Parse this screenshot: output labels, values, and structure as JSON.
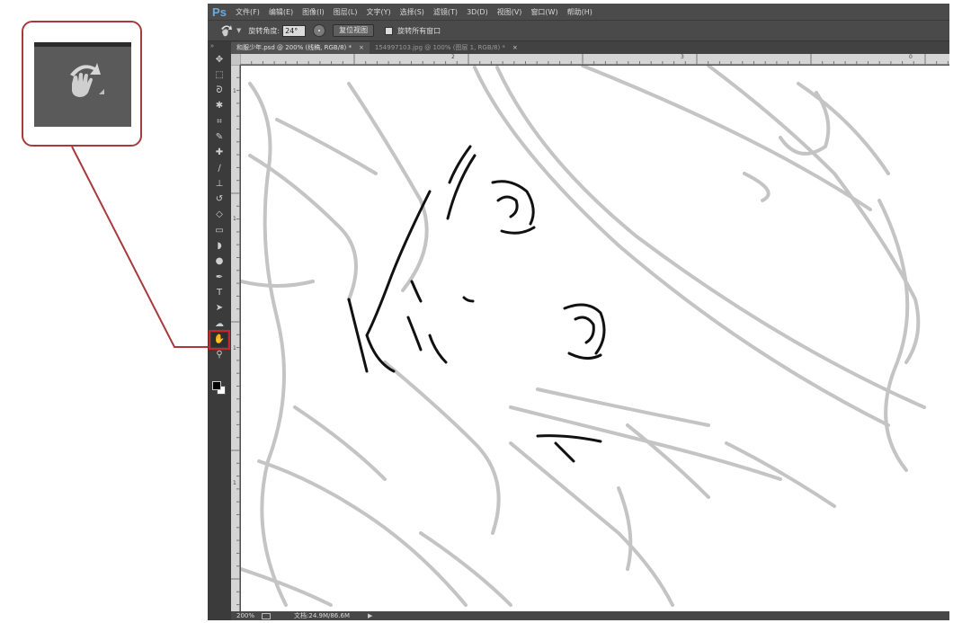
{
  "app": {
    "logo": "Ps",
    "menu": [
      "文件(F)",
      "编辑(E)",
      "图像(I)",
      "图层(L)",
      "文字(Y)",
      "选择(S)",
      "滤镜(T)",
      "3D(D)",
      "视图(V)",
      "窗口(W)",
      "帮助(H)"
    ]
  },
  "options": {
    "tool_icon": "rotate-view-icon",
    "angle_label": "旋转角度:",
    "angle_value": "24°",
    "reset_label": "复位视图",
    "rotate_all_label": "旋转所有窗口",
    "rotate_all_checked": false
  },
  "tabs": [
    {
      "label": "和服少年.psd @ 200% (线稿, RGB/8) *",
      "active": true,
      "close": "×"
    },
    {
      "label": "154997103.jpg @ 100% (图层 1, RGB/8) *",
      "active": false,
      "close": "×"
    }
  ],
  "toolbox": {
    "grip": "»",
    "tools": [
      {
        "name": "move-tool",
        "glyph": "✥"
      },
      {
        "name": "marquee-tool",
        "glyph": "⬚"
      },
      {
        "name": "lasso-tool",
        "glyph": "ᘐ"
      },
      {
        "name": "quick-select-tool",
        "glyph": "✱"
      },
      {
        "name": "crop-tool",
        "glyph": "⌗"
      },
      {
        "name": "eyedropper-tool",
        "glyph": "✎"
      },
      {
        "name": "healing-tool",
        "glyph": "✚"
      },
      {
        "name": "brush-tool",
        "glyph": "∕"
      },
      {
        "name": "stamp-tool",
        "glyph": "⊥"
      },
      {
        "name": "history-brush-tool",
        "glyph": "↺"
      },
      {
        "name": "eraser-tool",
        "glyph": "◇"
      },
      {
        "name": "gradient-tool",
        "glyph": "▭"
      },
      {
        "name": "blur-tool",
        "glyph": "◗"
      },
      {
        "name": "dodge-tool",
        "glyph": "●"
      },
      {
        "name": "pen-tool",
        "glyph": "✒"
      },
      {
        "name": "type-tool",
        "glyph": "T"
      },
      {
        "name": "path-select-tool",
        "glyph": "➤"
      },
      {
        "name": "shape-tool",
        "glyph": "☁"
      },
      {
        "name": "rotate-view-tool",
        "glyph": "✋",
        "active": true
      },
      {
        "name": "zoom-tool",
        "glyph": "⚲"
      }
    ]
  },
  "ruler": {
    "top_marks": [
      "2",
      "3",
      "0"
    ],
    "left_marks": [
      "1",
      "1",
      "1",
      "1"
    ]
  },
  "status": {
    "zoom": "200%",
    "doc_info": "文档:24.9M/86.6M",
    "arrow": "▶"
  },
  "callout": {
    "icon": "rotate-view-icon",
    "border_color": "#a73a3d"
  },
  "colors": {
    "accent": "#c8262b",
    "sketch_gray": "#c4c4c4",
    "ink": "#111111"
  }
}
